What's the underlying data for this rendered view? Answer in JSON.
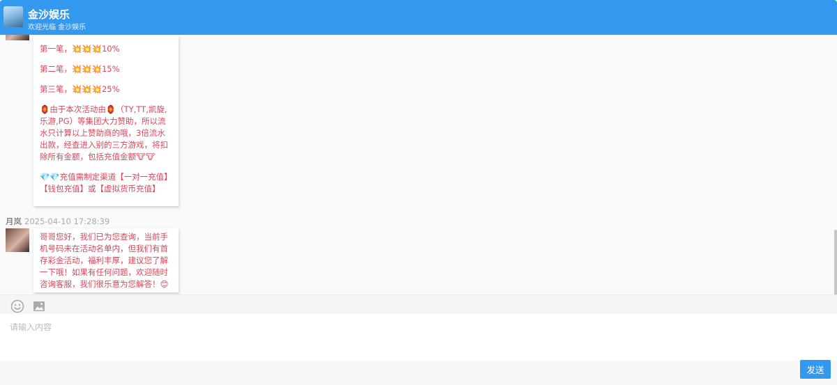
{
  "header": {
    "title": "金沙娱乐",
    "subtitle": "欢迎光临 金沙娱乐"
  },
  "messages": [
    {
      "sender": "",
      "time": "",
      "lines": [
        "第一笔，💥💥💥10%",
        "第二笔，💥💥💥15%",
        "第三笔，💥💥💥25%",
        "🏮由于本次活动由🏮（TY,TT,凯旋,乐游,PG）等集团大力赞助，所以流水只计算以上赞助商的哦，3倍流水出款，经查进入别的三方游戏，将扣除所有金额，包括充值金额🐮🐮",
        "💎💎充值需制定渠道【一对一充值】【钱包充值】或【虚拟货币充值】"
      ]
    },
    {
      "sender": "月岚",
      "time": "2025-04-10 17:28:39",
      "lines": [
        "哥哥您好，我们已为您查询，当前手机号码未在活动名单内，但我们有首存彩金活动，福利丰厚，建议您了解一下哦！如果有任何问题，欢迎随时咨询客服，我们很乐意为您解答！😊"
      ]
    }
  ],
  "toolbar": {
    "emoji_icon": "smiley-face-icon",
    "image_icon": "image-icon"
  },
  "input": {
    "placeholder": "请输入内容",
    "value": ""
  },
  "send_label": "发送",
  "colors": {
    "brand": "#3399ee",
    "message_text": "#d6475a"
  }
}
